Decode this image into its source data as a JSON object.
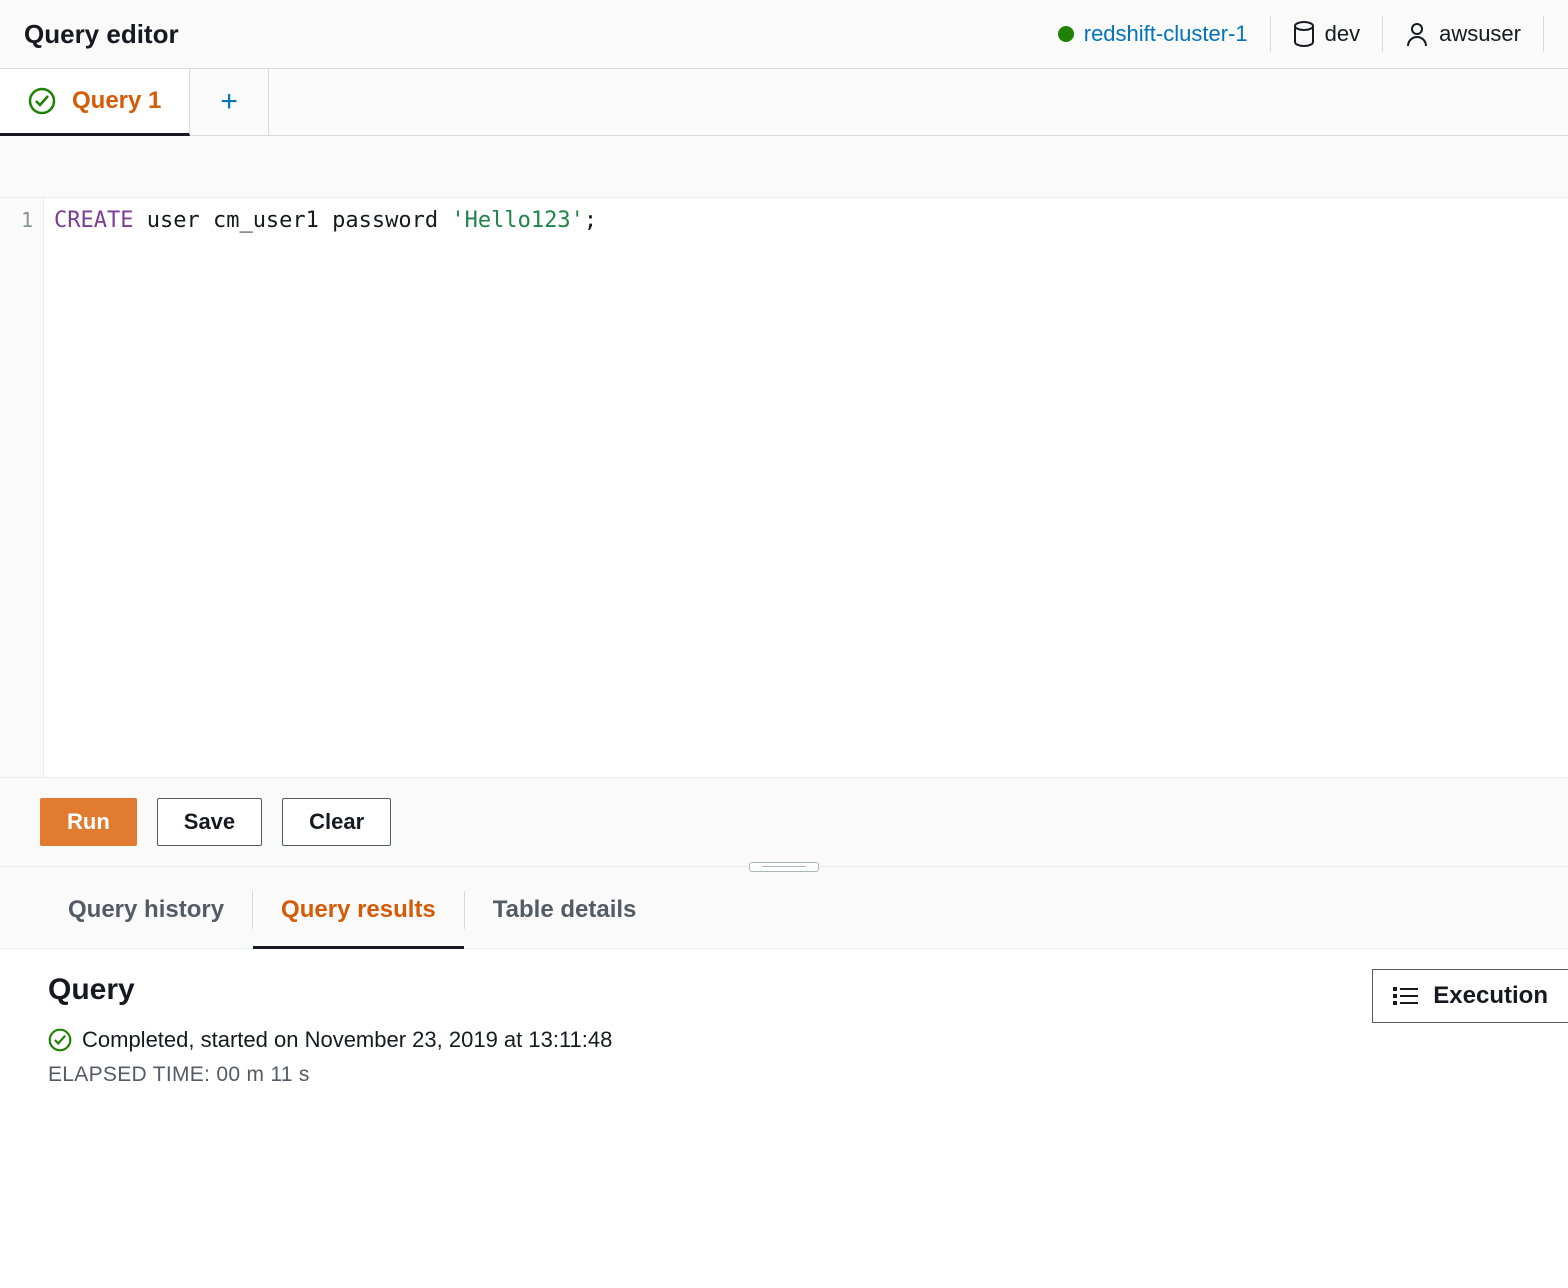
{
  "header": {
    "title": "Query editor",
    "cluster": "redshift-cluster-1",
    "database": "dev",
    "user": "awsuser"
  },
  "tabs": {
    "active_label": "Query 1"
  },
  "editor": {
    "line_number": "1",
    "sql_keyword": "CREATE",
    "sql_mid": " user cm_user1 password ",
    "sql_string": "'Hello123'",
    "sql_end": ";"
  },
  "actions": {
    "run": "Run",
    "save": "Save",
    "clear": "Clear"
  },
  "results_tabs": {
    "history": "Query history",
    "results": "Query results",
    "details": "Table details"
  },
  "query_panel": {
    "heading": "Query",
    "status": "Completed, started on November 23, 2019 at 13:11:48",
    "elapsed": "ELAPSED TIME: 00 m 11 s",
    "execution_label": "Execution"
  }
}
